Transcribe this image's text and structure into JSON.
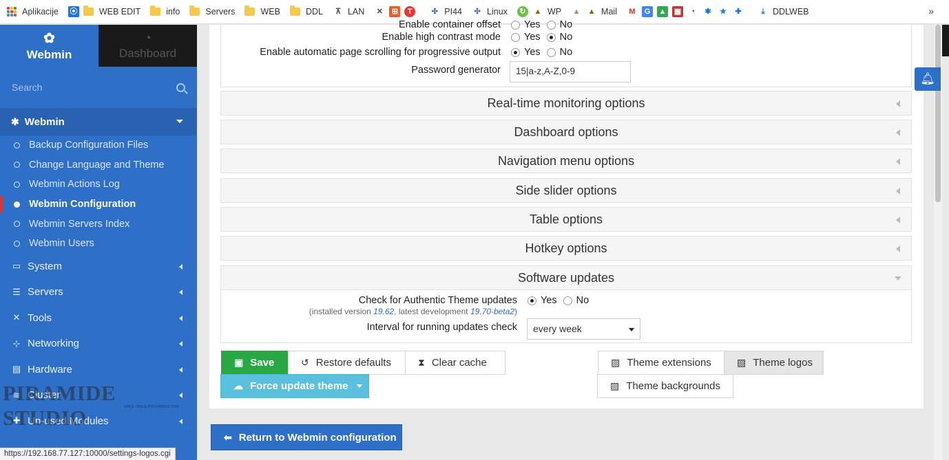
{
  "bookmarks": {
    "items": [
      "Aplikacije",
      "WEB EDIT",
      "info",
      "Servers",
      "WEB",
      "DDL",
      "LAN",
      "PI44",
      "Linux",
      "WP",
      "Mail",
      "DDLWEB"
    ],
    "more": "»"
  },
  "sidebar": {
    "brand": "Webmin",
    "dashboard": "Dashboard",
    "search_placeholder": "Search",
    "section": "Webmin",
    "sub_items": [
      "Backup Configuration Files",
      "Change Language and Theme",
      "Webmin Actions Log",
      "Webmin Configuration",
      "Webmin Servers Index",
      "Webmin Users"
    ],
    "active_sub": "Webmin Configuration",
    "categories": [
      "System",
      "Servers",
      "Tools",
      "Networking",
      "Hardware",
      "Cluster",
      "Un-used Modules"
    ],
    "watermark": "PIRAMIDE STUDIO",
    "watermark_sub": "SINCE 1995 AUDIO PRODUCTION"
  },
  "options": {
    "row0_partial_yes": "Yes",
    "row0_partial_no": "No",
    "row0_label": "Enable container offset",
    "contrast_label": "Enable high contrast mode",
    "scroll_label": "Enable automatic page scrolling for progressive output",
    "password_label": "Password generator",
    "password_value": "15|a-z,A-Z,0-9",
    "yes": "Yes",
    "no": "No"
  },
  "sections": [
    "Real-time monitoring options",
    "Dashboard options",
    "Navigation menu options",
    "Side slider options",
    "Table options",
    "Hotkey options",
    "Software updates"
  ],
  "updates": {
    "check_label": "Check for Authentic Theme updates",
    "installed_prefix": "(installed version ",
    "installed_version": "19.62",
    "latest_mid": ", latest development ",
    "latest_version": "19.70-beta2",
    "close_paren": ")",
    "interval_label": "Interval for running updates check",
    "interval_value": "every week"
  },
  "buttons": {
    "save": "Save",
    "restore": "Restore defaults",
    "clear": "Clear cache",
    "force": "Force update theme",
    "extensions": "Theme extensions",
    "logos": "Theme logos",
    "backgrounds": "Theme backgrounds",
    "return": "Return to Webmin configuration"
  },
  "status_url": "https://192.168.77.127:10000/settings-logos.cgi"
}
